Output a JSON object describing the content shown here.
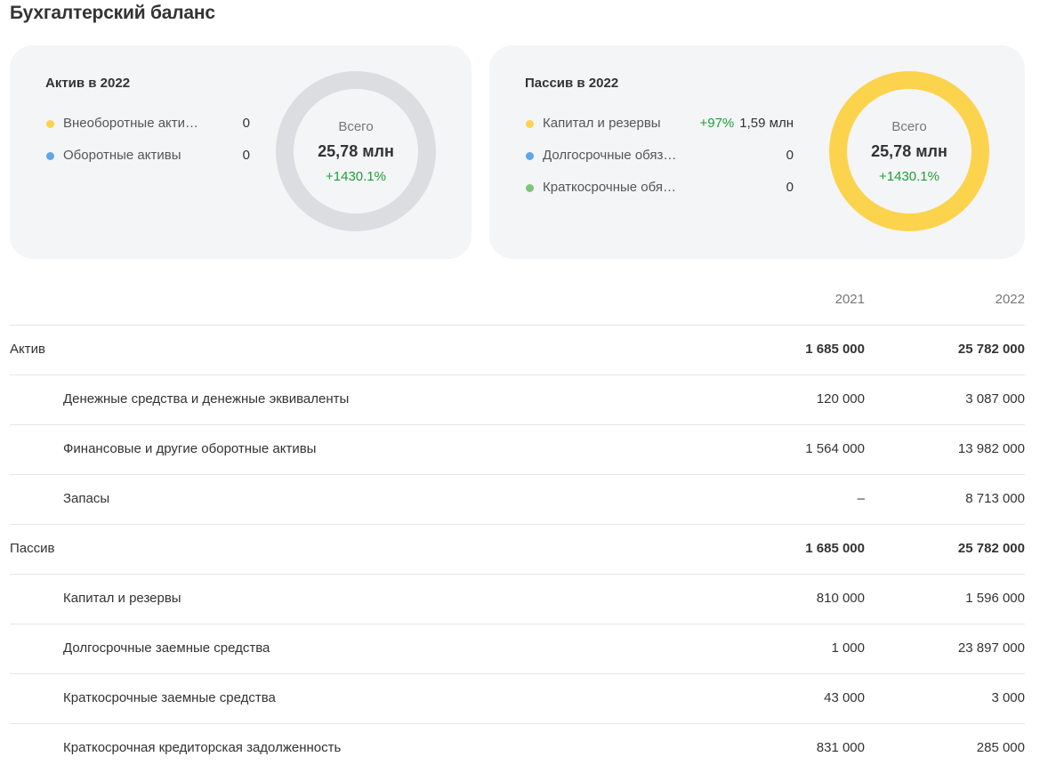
{
  "page": {
    "title": "Бухгалтерский баланс"
  },
  "colors": {
    "yellow": "#fcd34d",
    "blue": "#60a5e8",
    "green": "#7cc87a",
    "grey_ring": "#dcdde0",
    "positive": "#1f9e3b"
  },
  "assets_card": {
    "title": "Актив в 2022",
    "legend": [
      {
        "label": "Внеоборотные акти…",
        "value": "0",
        "color": "#fcd34d"
      },
      {
        "label": "Оборотные активы",
        "value": "0",
        "color": "#60a5e8"
      }
    ],
    "donut": {
      "caption": "Всего",
      "total": "25,78 млн",
      "growth": "+1430.1%",
      "ring_color": "#dcdde0"
    }
  },
  "liabilities_card": {
    "title": "Пассив в 2022",
    "legend": [
      {
        "label": "Капитал и резервы",
        "delta": "+97%",
        "value": "1,59 млн",
        "color": "#fcd34d"
      },
      {
        "label": "Долгосрочные обяз…",
        "value": "0",
        "color": "#60a5e8"
      },
      {
        "label": "Краткосрочные обя…",
        "value": "0",
        "color": "#7cc87a"
      }
    ],
    "donut": {
      "caption": "Всего",
      "total": "25,78 млн",
      "growth": "+1430.1%",
      "ring_color": "#fcd34d"
    }
  },
  "table": {
    "columns": [
      "2021",
      "2022"
    ],
    "rows": [
      {
        "name": "Актив",
        "v2021": "1 685 000",
        "v2022": "25 782 000",
        "group": true
      },
      {
        "name": "Денежные средства и денежные эквиваленты",
        "v2021": "120 000",
        "v2022": "3 087 000",
        "group": false
      },
      {
        "name": "Финансовые и другие оборотные активы",
        "v2021": "1 564 000",
        "v2022": "13 982 000",
        "group": false
      },
      {
        "name": "Запасы",
        "v2021": "–",
        "v2022": "8 713 000",
        "group": false
      },
      {
        "name": "Пассив",
        "v2021": "1 685 000",
        "v2022": "25 782 000",
        "group": true
      },
      {
        "name": "Капитал и резервы",
        "v2021": "810 000",
        "v2022": "1 596 000",
        "group": false
      },
      {
        "name": "Долгосрочные заемные средства",
        "v2021": "1 000",
        "v2022": "23 897 000",
        "group": false
      },
      {
        "name": "Краткосрочные заемные средства",
        "v2021": "43 000",
        "v2022": "3 000",
        "group": false
      },
      {
        "name": "Краткосрочная кредиторская задолженность",
        "v2021": "831 000",
        "v2022": "285 000",
        "group": false
      }
    ]
  }
}
